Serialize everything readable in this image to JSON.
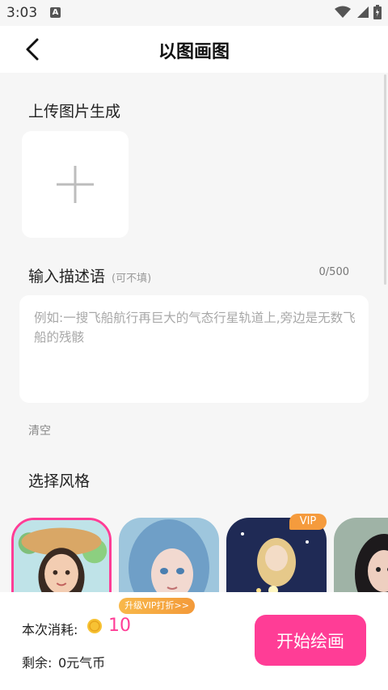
{
  "status_bar": {
    "time": "3:03",
    "app_icon_letter": "A"
  },
  "header": {
    "title": "以图画图",
    "back_icon": "chevron-left-icon"
  },
  "upload": {
    "title": "上传图片生成",
    "icon": "plus-icon"
  },
  "description": {
    "title": "输入描述语",
    "hint": "(可不填)",
    "counter": "0/500",
    "placeholder": "例如:一搜飞船航行再巨大的气态行星轨道上,旁边是无数飞船的残骸",
    "value": ""
  },
  "clear_label": "清空",
  "style_section": {
    "title": "选择风格",
    "items": [
      {
        "name": "sunhat-girl",
        "selected": true,
        "vip": false
      },
      {
        "name": "blue-hair-girl",
        "selected": false,
        "vip": false
      },
      {
        "name": "night-fairy",
        "selected": false,
        "vip": true
      },
      {
        "name": "dark-hair-girl",
        "selected": false,
        "vip": false
      }
    ],
    "vip_label": "VIP"
  },
  "footer": {
    "upgrade_label": "升级VIP打折>>",
    "cost_label": "本次消耗:",
    "cost_value": "10",
    "remain_label": "剩余:",
    "remain_value": "0元气币",
    "start_button": "开始绘画"
  },
  "colors": {
    "accent": "#ff3d96",
    "vip": "#f59b3d",
    "background": "#f6f6f6"
  }
}
